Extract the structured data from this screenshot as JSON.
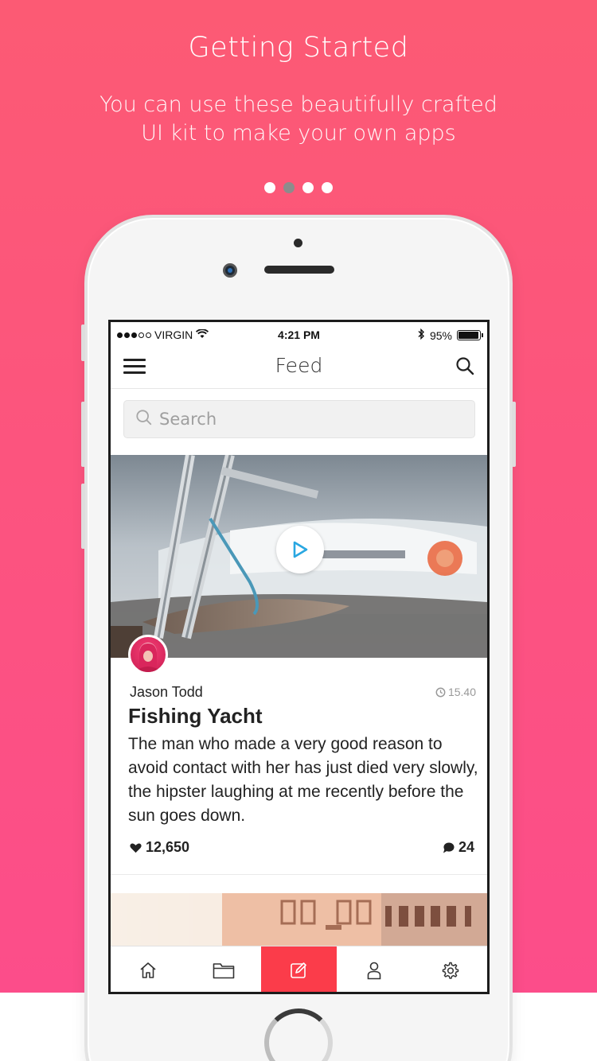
{
  "onboarding": {
    "title": "Getting Started",
    "subtitle_line1": "You can use these beautifully crafted",
    "subtitle_line2": "UI kit to make your own apps",
    "page_indicator": {
      "total": 4,
      "current": 2
    }
  },
  "status_bar": {
    "carrier": "VIRGIN",
    "time": "4:21 PM",
    "battery_text": "95%",
    "battery_level": 0.95
  },
  "nav": {
    "title": "Feed",
    "menu_icon": "hamburger-icon",
    "search_icon": "search-icon"
  },
  "search": {
    "placeholder": "Search"
  },
  "post": {
    "author": "Jason Todd",
    "time": "15.40",
    "title": "Fishing Yacht",
    "body": "The man who made a very good reason to avoid contact with her has just died very slowly, the hipster laughing at me recently before the sun goes down.",
    "likes": "12,650",
    "comments": "24"
  },
  "tabbar": {
    "tabs": [
      {
        "name": "home",
        "icon": "home-icon"
      },
      {
        "name": "folder",
        "icon": "folder-icon"
      },
      {
        "name": "compose",
        "icon": "compose-icon",
        "active": true
      },
      {
        "name": "profile",
        "icon": "person-icon"
      },
      {
        "name": "settings",
        "icon": "gear-icon"
      }
    ]
  },
  "colors": {
    "background_top": "#fc5a74",
    "background_bottom": "#fc4d8a",
    "active_tab": "#fb3c4a",
    "play_icon": "#29a7e1"
  }
}
